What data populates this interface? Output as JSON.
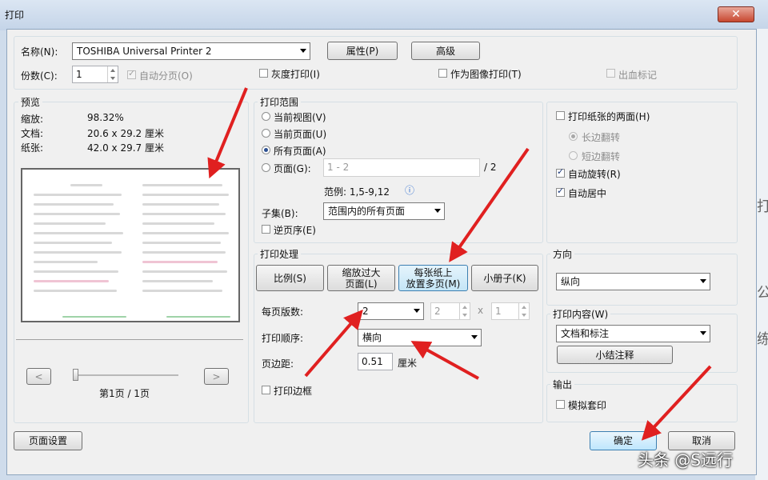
{
  "window": {
    "title": "打印",
    "close_glyph": "✕"
  },
  "printer": {
    "name_label": "名称(N):",
    "name_value": "TOSHIBA Universal Printer 2",
    "properties_button": "属性(P)",
    "advanced_button": "高级",
    "copies_label": "份数(C):",
    "copies_value": "1",
    "collate_label": "自动分页(O)",
    "grayscale_label": "灰度打印(I)",
    "print_as_image_label": "作为图像打印(T)",
    "bleed_marks_label": "出血标记"
  },
  "preview": {
    "group_label": "预览",
    "zoom_label": "缩放:",
    "zoom_value": "98.32%",
    "document_label": "文档:",
    "document_value": "20.6 x 29.2 厘米",
    "paper_label": "纸张:",
    "paper_value": "42.0 x 29.7 厘米",
    "prev_button": "<",
    "next_button": ">",
    "page_indicator": "第1页 / 1页",
    "slider_value": 0
  },
  "print_range": {
    "group_label": "打印范围",
    "current_view": "当前视图(V)",
    "current_page": "当前页面(U)",
    "all_pages": "所有页面(A)",
    "pages_label": "页面(G):",
    "pages_placeholder": "1 - 2",
    "pages_total": "/ 2",
    "example_label": "范例: 1,5-9,12",
    "info_icon": "ⓘ",
    "subset_label": "子集(B):",
    "subset_value": "范围内的所有页面",
    "reverse_label": "逆页序(E)"
  },
  "page_handling": {
    "group_label": "打印处理",
    "tab_scale": "比例(S)",
    "tab_fit_line1": "缩放过大",
    "tab_fit_line2": "页面(L)",
    "tab_multiple_line1": "每张纸上",
    "tab_multiple_line2": "放置多页(M)",
    "tab_booklet": "小册子(K)",
    "pages_per_sheet_label": "每页版数:",
    "pages_per_sheet_value": "2",
    "cols_value": "2",
    "times_glyph": "x",
    "rows_value": "1",
    "page_order_label": "打印顺序:",
    "page_order_value": "横向",
    "margin_label": "页边距:",
    "margin_value": "0.51",
    "margin_unit": "厘米",
    "print_border_label": "打印边框"
  },
  "duplex": {
    "both_sides_label": "打印纸张的两面(H)",
    "flip_long_label": "长边翻转",
    "flip_short_label": "短边翻转",
    "auto_rotate_label": "自动旋转(R)",
    "auto_center_label": "自动居中"
  },
  "orientation": {
    "group_label": "方向",
    "value": "纵向"
  },
  "content": {
    "group_label": "打印内容(W)",
    "value": "文档和标注",
    "summary_button": "小结注释"
  },
  "output": {
    "group_label": "输出",
    "simulate_overprint_label": "模拟套印"
  },
  "footer": {
    "page_setup_button": "页面设置",
    "ok_button": "确定",
    "cancel_button": "取消"
  },
  "watermark": "头条 @S远行",
  "background_chars": [
    "打",
    "公",
    "练"
  ],
  "colors": {
    "arrow": "#e02020",
    "accent": "#3c7fb1"
  }
}
